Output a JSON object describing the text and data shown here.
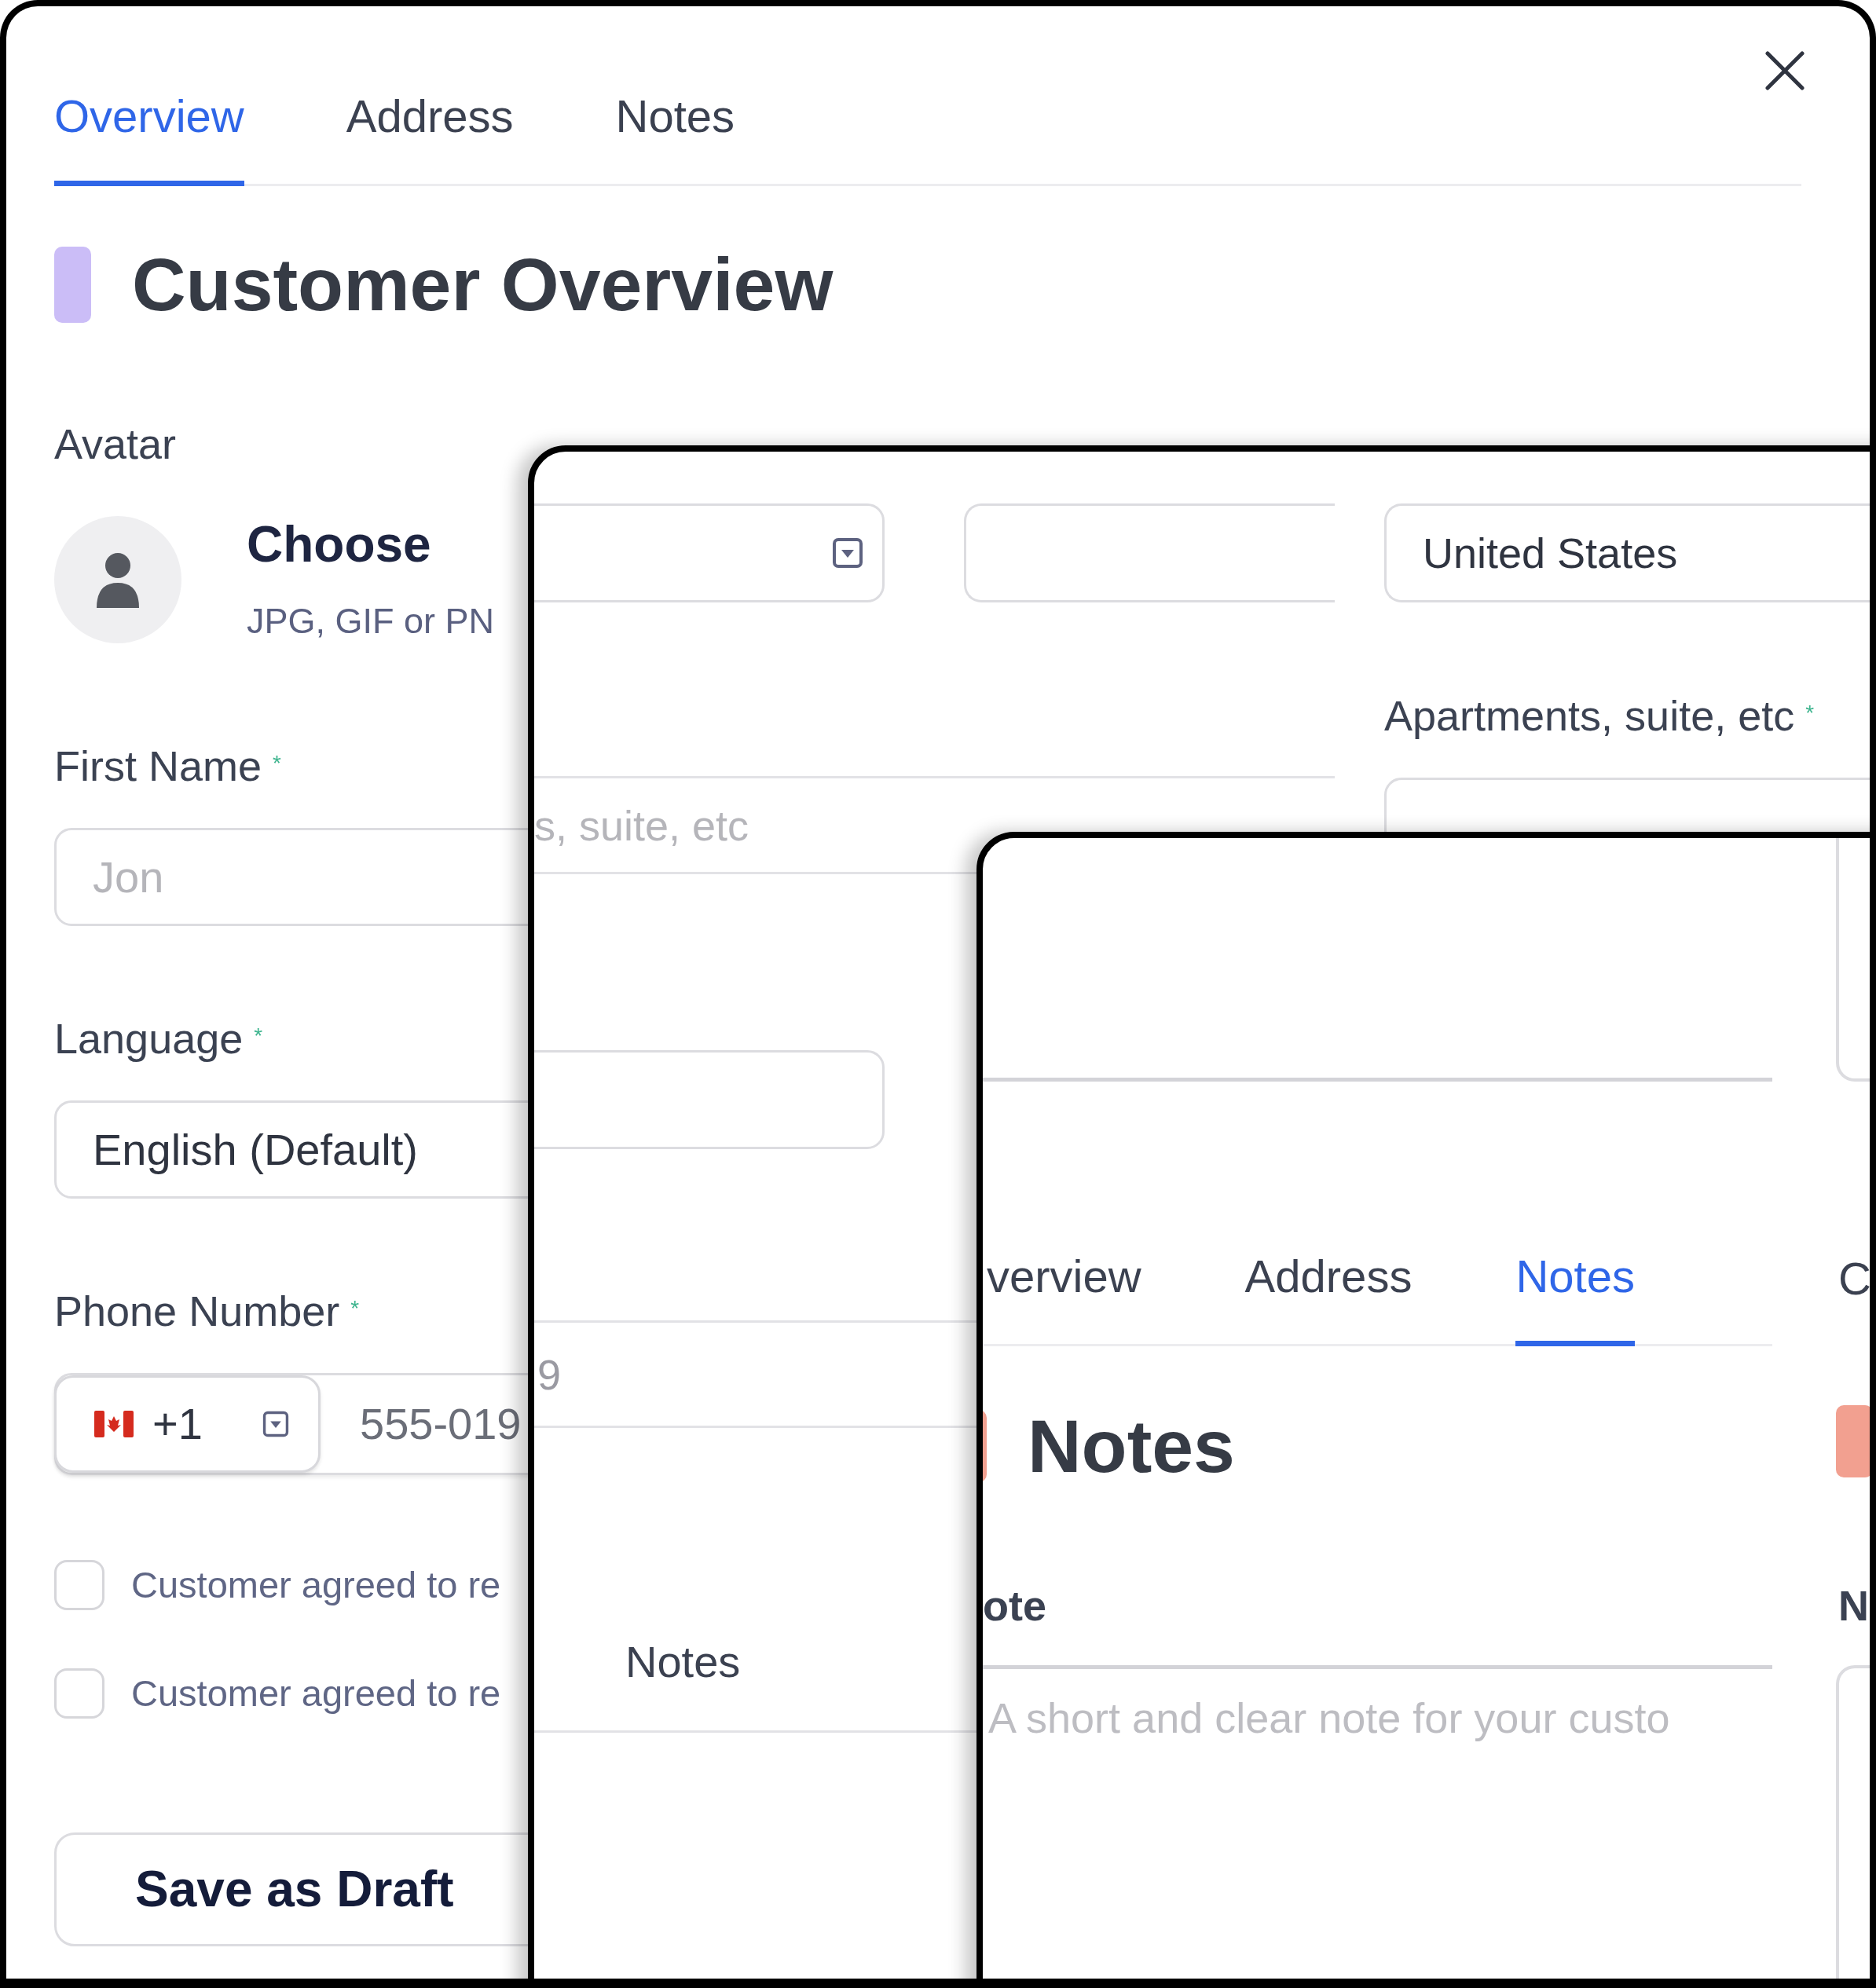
{
  "overview_panel": {
    "tabs": [
      {
        "label": "Overview",
        "selected": true
      },
      {
        "label": "Address",
        "selected": false
      },
      {
        "label": "Notes",
        "selected": false
      }
    ],
    "title": "Customer Overview",
    "avatar": {
      "label": "Avatar",
      "action": "Choose",
      "hint": "JPG, GIF or PN"
    },
    "first_name": {
      "label": "First Name",
      "mark": "*",
      "placeholder": "Jon"
    },
    "language": {
      "label": "Language",
      "mark": "*",
      "value": "English (Default)"
    },
    "phone": {
      "label": "Phone Number",
      "mark": "*",
      "code": "+1",
      "placeholder": "555-019"
    },
    "consents": [
      {
        "label": "Customer agreed to re",
        "checked": false
      },
      {
        "label": "Customer agreed to re",
        "checked": false
      }
    ],
    "save_button": "Save as Draft"
  },
  "address_panel": {
    "country": "United States",
    "apartments": {
      "label": "Apartments, suite, etc",
      "mark": "*"
    },
    "street_placeholder": "s, suite, etc",
    "fragment": "9",
    "notes_item": "Notes"
  },
  "notes_panel": {
    "tabs": [
      {
        "label": "verview",
        "selected": false
      },
      {
        "label": "Address",
        "selected": false
      },
      {
        "label": "Notes",
        "selected": true
      }
    ],
    "side_tab": "C",
    "title": "Notes",
    "note_label": "ote",
    "side_label": "N",
    "note_placeholder": "A short and clear note for your custo"
  }
}
